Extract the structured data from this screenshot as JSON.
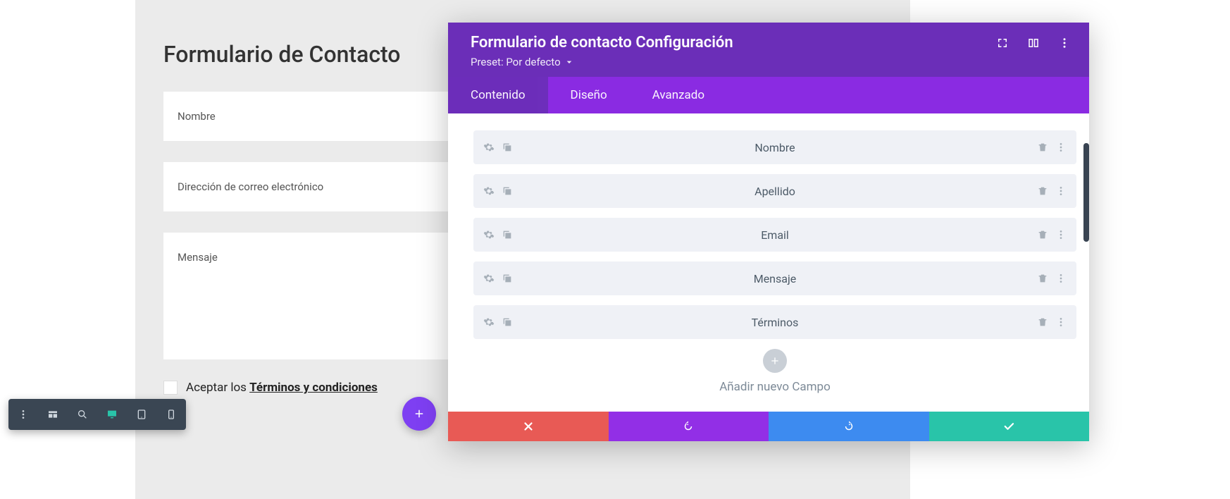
{
  "canvas": {
    "heading": "Formulario de Contacto",
    "fields": {
      "name": "Nombre",
      "email": "Dirección de correo electrónico",
      "message": "Mensaje"
    },
    "terms_prefix": "Aceptar los ",
    "terms_link": "Términos y condiciones"
  },
  "panel": {
    "title": "Formulario de contacto Configuración",
    "preset_label": "Preset: Por defecto",
    "tabs": {
      "content": "Contenido",
      "design": "Diseño",
      "advanced": "Avanzado"
    },
    "rows": [
      {
        "label": "Nombre"
      },
      {
        "label": "Apellido"
      },
      {
        "label": "Email"
      },
      {
        "label": "Mensaje"
      },
      {
        "label": "Términos"
      }
    ],
    "add_label": "Añadir nuevo Campo"
  },
  "icons": {
    "expand": "expand-icon",
    "columns": "columns-icon",
    "more": "more-vertical-icon",
    "gear": "gear-icon",
    "copy": "duplicate-icon",
    "trash": "trash-icon",
    "plus": "plus-icon",
    "close": "close-icon",
    "undo": "undo-icon",
    "redo": "redo-icon",
    "check": "check-icon",
    "wireframe": "wireframe-icon",
    "zoom": "zoom-icon",
    "desktop": "desktop-icon",
    "tablet": "tablet-icon",
    "phone": "phone-icon",
    "caret": "caret-down-icon"
  }
}
